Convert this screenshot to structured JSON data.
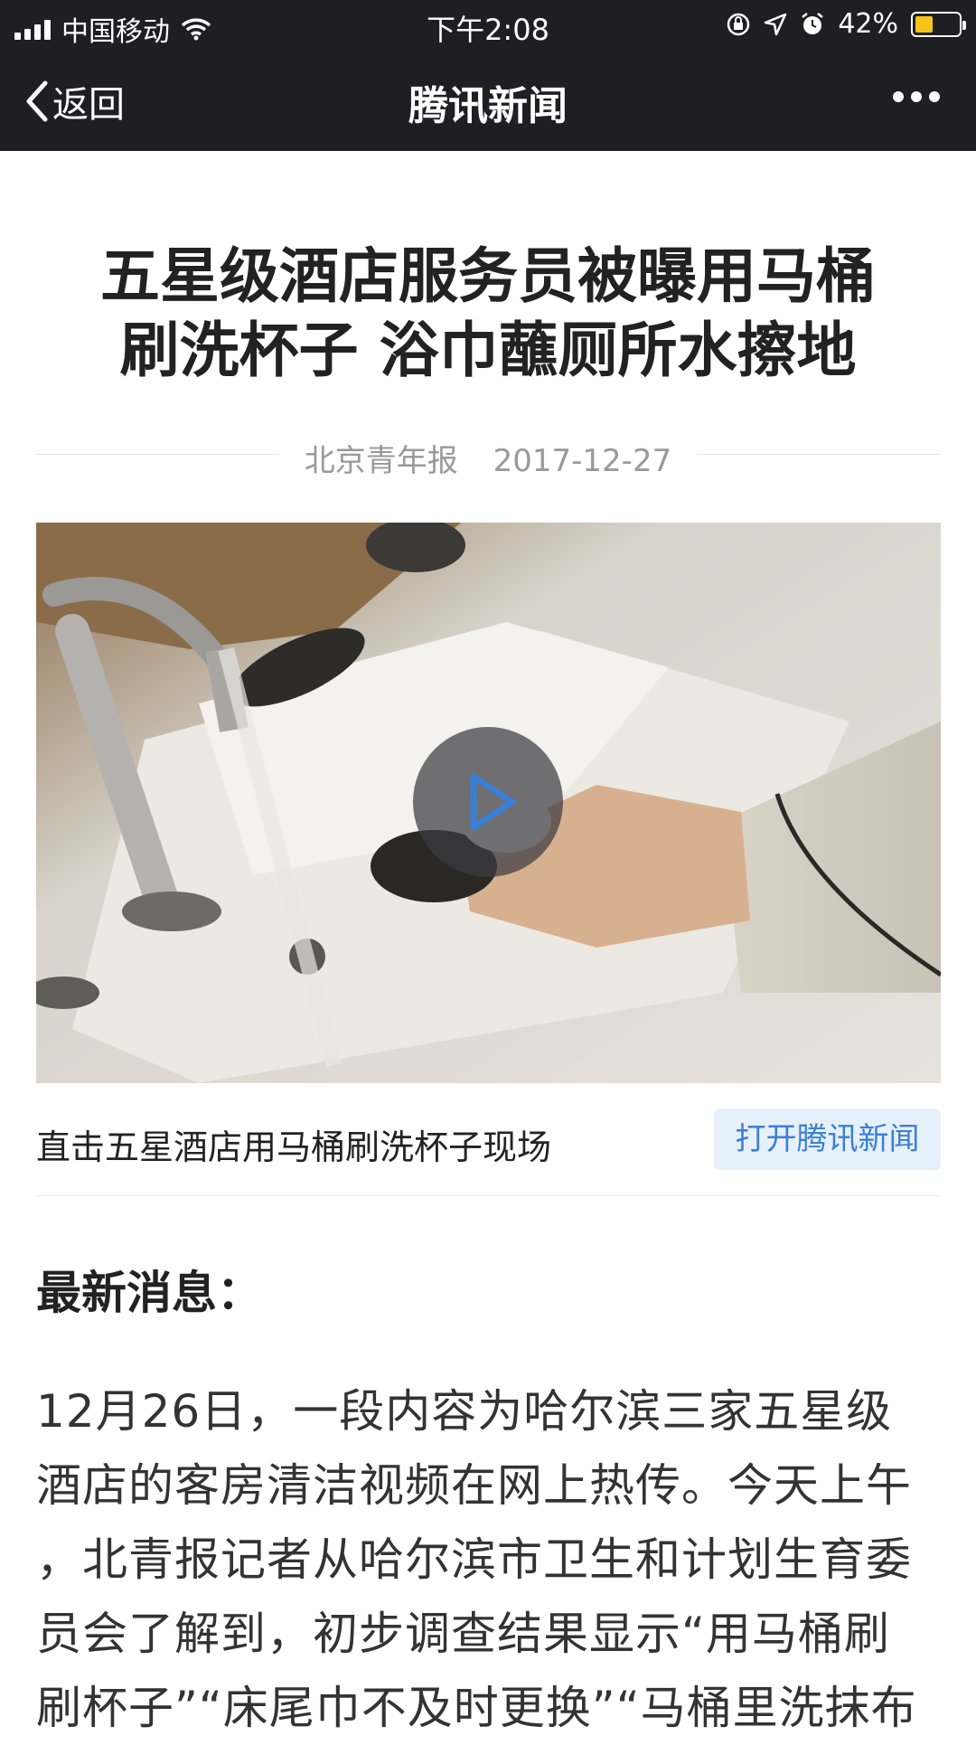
{
  "status_bar": {
    "carrier": "中国移动",
    "time": "下午2:08",
    "battery_percent": "42%",
    "battery_level": 0.42
  },
  "nav": {
    "back_label": "返回",
    "title": "腾讯新闻"
  },
  "article": {
    "headline_line1": "五星级酒店服务员被曝用马桶",
    "headline_line2": "刷洗杯子 浴巾蘸厕所水擦地",
    "source": "北京青年报",
    "date": "2017-12-27",
    "video_caption": "直击五星酒店用马桶刷洗杯子现场",
    "open_app_label": "打开腾讯新闻",
    "section_title": "最新消息：",
    "body_lines": [
      "12月26日，一段内容为哈尔滨三家五星级",
      "酒店的客房清洁视频在网上热传。今天上午",
      "，北青报记者从哈尔滨市卫生和计划生育委",
      "员会了解到，初步调查结果显示“用马桶刷",
      "刷杯子”“床尾巾不及时更换”“马桶里洗抹布"
    ]
  },
  "colors": {
    "bar_bg": "#1f1f23",
    "link_blue": "#3a7fd5",
    "battery_yellow": "#f5c518"
  }
}
